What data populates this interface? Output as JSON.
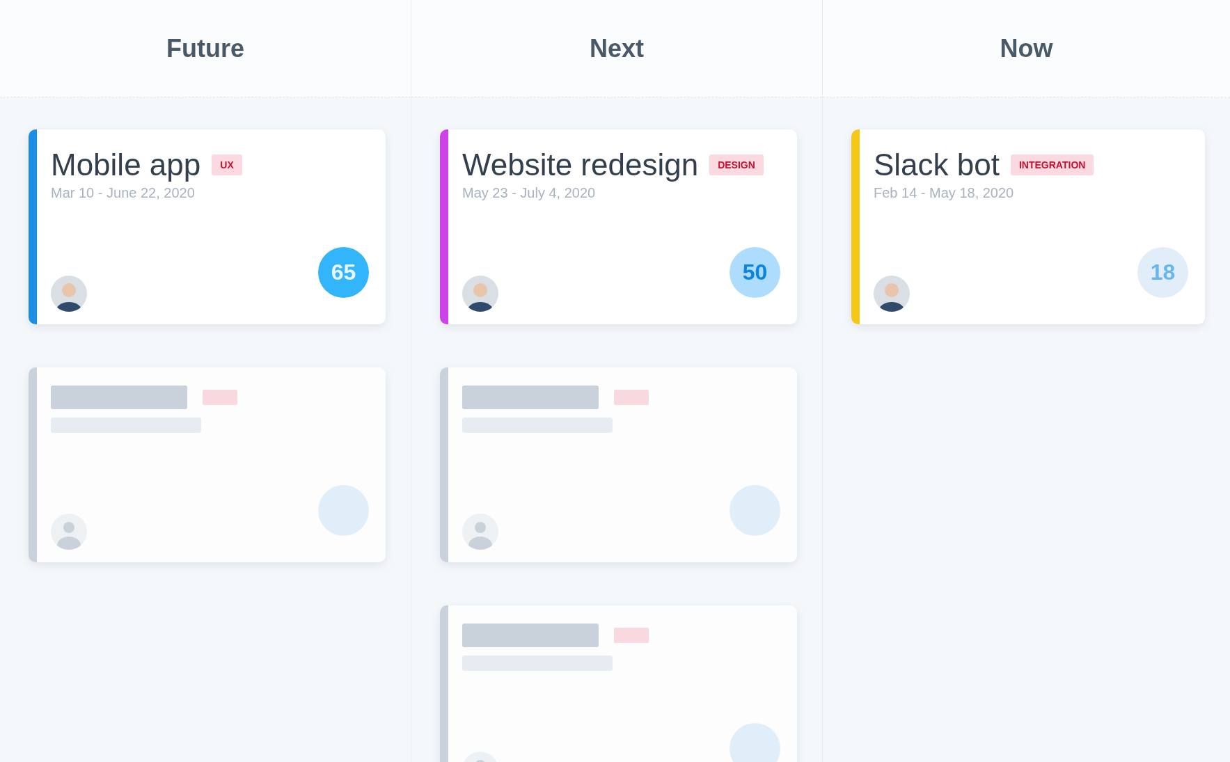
{
  "columns": [
    {
      "title": "Future",
      "cards": [
        {
          "kind": "project",
          "title": "Mobile app",
          "tag": "UX",
          "dates": "Mar 10 - June 22, 2020",
          "color": "#1b8ee6",
          "score": {
            "value": "65",
            "color": "#33b5fb"
          }
        },
        {
          "kind": "placeholder"
        }
      ]
    },
    {
      "title": "Next",
      "cards": [
        {
          "kind": "project",
          "title": "Website redesign",
          "tag": "DESIGN",
          "dates": "May 23 - July 4, 2020",
          "color": "#cc44e8",
          "score": {
            "value": "50",
            "color": "#aedcfd"
          }
        },
        {
          "kind": "placeholder"
        },
        {
          "kind": "placeholder"
        }
      ]
    },
    {
      "title": "Now",
      "cards": [
        {
          "kind": "project",
          "title": "Slack bot",
          "tag": "INTEGRATION",
          "dates": "Feb 14 - May 18, 2020",
          "color": "#f6c816",
          "score": {
            "value": "18",
            "color": "#e1eefa"
          }
        }
      ]
    }
  ]
}
